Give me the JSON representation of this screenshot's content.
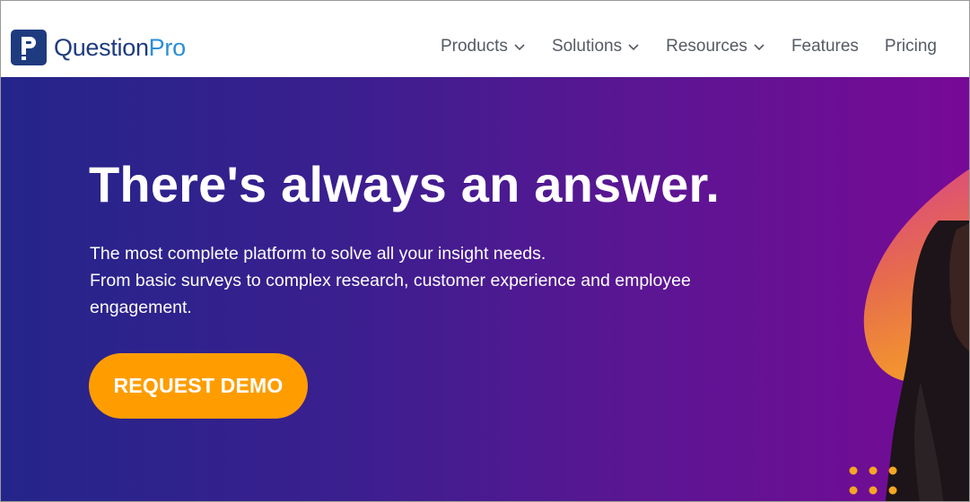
{
  "brand": {
    "name_part1": "Question",
    "name_part2": "Pro",
    "logo_icon": "questionpro-p-icon",
    "primary_color": "#1f3b7f",
    "accent_color": "#2a8fd6"
  },
  "nav": {
    "items": [
      {
        "label": "Products",
        "has_dropdown": true
      },
      {
        "label": "Solutions",
        "has_dropdown": true
      },
      {
        "label": "Resources",
        "has_dropdown": true
      },
      {
        "label": "Features",
        "has_dropdown": false
      },
      {
        "label": "Pricing",
        "has_dropdown": false
      }
    ]
  },
  "hero": {
    "title": "There's always an answer.",
    "subtitle_line1": "The most complete platform to solve all your insight needs.",
    "subtitle_line2": "From basic surveys to complex research, customer experience and employee engagement.",
    "cta_label": "REQUEST DEMO",
    "cta_color": "#ff9d00",
    "gradient_start": "#24258a",
    "gradient_end": "#770a96"
  }
}
